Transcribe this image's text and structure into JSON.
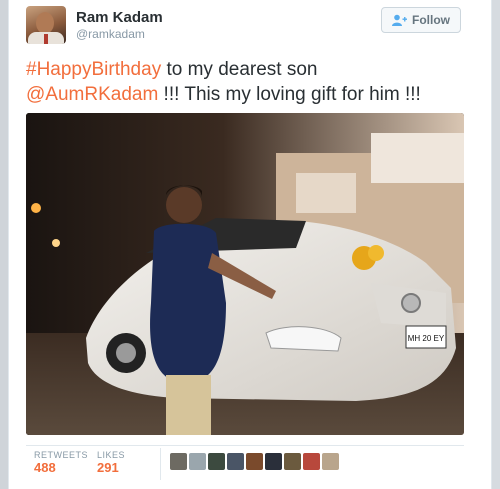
{
  "user": {
    "display_name": "Ram Kadam",
    "handle": "@ramkadam"
  },
  "follow_button": {
    "label": "Follow",
    "icon": "follow-person-plus-icon"
  },
  "tweet": {
    "hashtag": "#HappyBirthday",
    "text_1": " to my dearest son",
    "mention": "@AumRKadam",
    "text_2": " !!! This my loving gift for him !!!"
  },
  "photo": {
    "subject": "tweet-photo-boy-with-white-car",
    "plate_text": "MH 20 EY"
  },
  "stats": {
    "retweets_label": "RETWEETS",
    "retweets_value": "488",
    "likes_label": "LIKES",
    "likes_value": "291"
  },
  "likers": [
    {
      "name": "liker-avatar-1",
      "color": "#6d6a62"
    },
    {
      "name": "liker-avatar-2",
      "color": "#9aa6ad"
    },
    {
      "name": "liker-avatar-3",
      "color": "#3c4a3f"
    },
    {
      "name": "liker-avatar-4",
      "color": "#4a5566"
    },
    {
      "name": "liker-avatar-5",
      "color": "#7a4a2c"
    },
    {
      "name": "liker-avatar-6",
      "color": "#2a2f3a"
    },
    {
      "name": "liker-avatar-7",
      "color": "#6b5a3e"
    },
    {
      "name": "liker-avatar-8",
      "color": "#b8483c"
    },
    {
      "name": "liker-avatar-9",
      "color": "#b9a58c"
    }
  ],
  "colors": {
    "link": "#f26e3c",
    "text": "#292f33",
    "muted": "#8899a6"
  }
}
